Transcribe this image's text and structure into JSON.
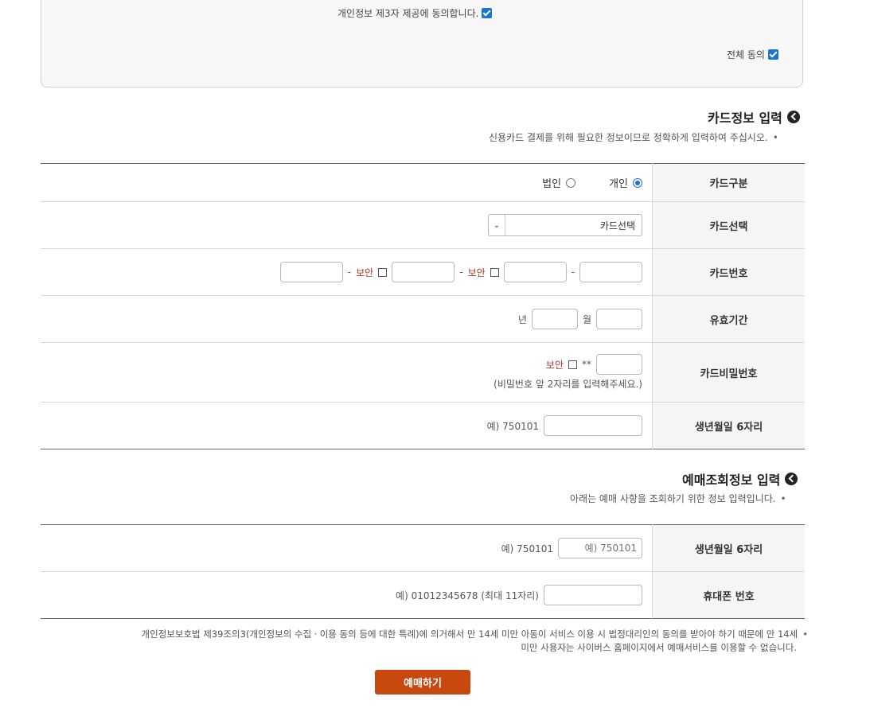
{
  "consent": {
    "third_party_label": "개인정보 제3자 제공에 동의합니다.",
    "all_label": "전체 동의"
  },
  "card_section": {
    "title": "카드정보 입력",
    "note": "신용카드 결제를 위해 필요한 정보이므로 정확하게 입력하여 주십시오.",
    "rows": {
      "type_label": "카드구분",
      "type_personal": "개인",
      "type_corporate": "법인",
      "select_label": "카드선택",
      "select_value": "카드선택",
      "number_label": "카드번호",
      "number_sep": "-",
      "secure_label": "보안",
      "expiry_label": "유효기간",
      "month_unit": "월",
      "year_unit": "년",
      "pw_label": "카드비밀번호",
      "pw_mask": "**",
      "pw_hint": "(비밀번호 앞 2자리를 입력해주세요.)",
      "birth_label": "생년월일 6자리",
      "birth_example": "예) 750101"
    }
  },
  "lookup_section": {
    "title": "예매조회정보 입력",
    "note": "아래는 예매 사항을 조회하기 위한 정보 입력입니다.",
    "rows": {
      "birth_label": "생년월일 6자리",
      "birth_placeholder": "예) 750101",
      "birth_example": "예) 750101",
      "phone_label": "휴대폰 번호",
      "phone_example": "예) 01012345678 (최대 11자리)"
    }
  },
  "footer_note": {
    "line1": "개인정보보호법 제39조의3(개인정보의 수집ㆍ이용 동의 등에 대한 특례)에 의거해서 만 14세 미만 아동이 서비스 이용 시 법정대리인의 동의를 받아야 하기 때문에 만 14세",
    "line2": "미만 사용자는 사이버스 홈페이지에서 예매서비스를 이용할 수 없습니다."
  },
  "submit": {
    "label": "예매하기"
  },
  "colors": {
    "accent": "#1a73d9",
    "button": "#c8480f",
    "secure_text": "#b2322b"
  }
}
